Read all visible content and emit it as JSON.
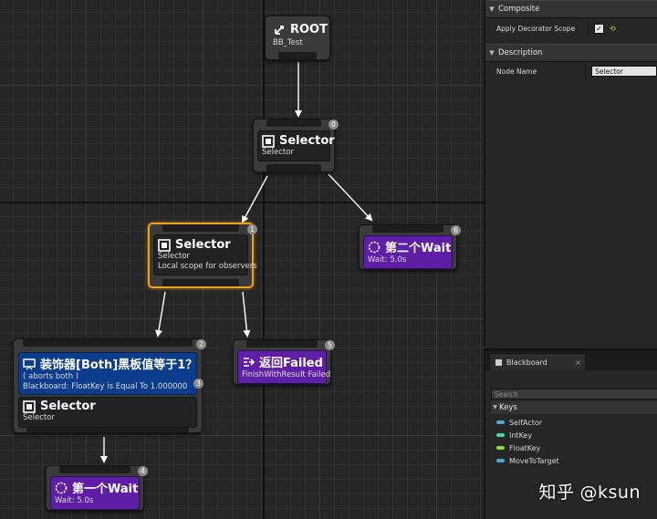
{
  "graph": {
    "root": {
      "title": "ROOT",
      "subtitle": "BB_Test"
    },
    "selector_main": {
      "title": "Selector",
      "subtitle": "Selector",
      "index": "0"
    },
    "selector_left": {
      "title": "Selector",
      "subtitle": "Selector",
      "detail": "Local scope for observers",
      "index": "1"
    },
    "wait_second": {
      "title": "第二个Wait",
      "subtitle": "Wait: 5.0s",
      "index": "6"
    },
    "decorator": {
      "title": "装饰器[Both]黑板值等于1？",
      "line1": "( aborts both )",
      "line2": "Blackboard: FloatKey is Equal To 1.000000",
      "index_top": "2",
      "index_inner": "3"
    },
    "selector_inner": {
      "title": "Selector",
      "subtitle": "Selector"
    },
    "return_failed": {
      "title": "返回Failed",
      "subtitle": "FinishWithResult Failed",
      "index": "5"
    },
    "wait_first": {
      "title": "第一个Wait",
      "subtitle": "Wait: 5.0s",
      "index": "4"
    }
  },
  "details": {
    "composite": {
      "header": "Composite",
      "apply_decorator_scope_label": "Apply Decorator Scope",
      "apply_decorator_scope_checked": true
    },
    "description": {
      "header": "Description",
      "node_name_label": "Node Name",
      "node_name_value": "Selector"
    }
  },
  "blackboard": {
    "tab_label": "Blackboard",
    "search_placeholder": "Search",
    "keys_header": "Keys",
    "keys": [
      {
        "name": "SelfActor",
        "color": "#4fa8d6"
      },
      {
        "name": "IntKey",
        "color": "#4fd6a0"
      },
      {
        "name": "FloatKey",
        "color": "#8bdc3a"
      },
      {
        "name": "MoveToTarget",
        "color": "#4fa8d6"
      }
    ]
  },
  "watermark": {
    "site": "知乎",
    "user": "@ksun"
  },
  "colors": {
    "selection": "#f0a218",
    "task": "#5e1ea6",
    "decorator": "#0c3c8c",
    "node": "#3a3a3a"
  }
}
